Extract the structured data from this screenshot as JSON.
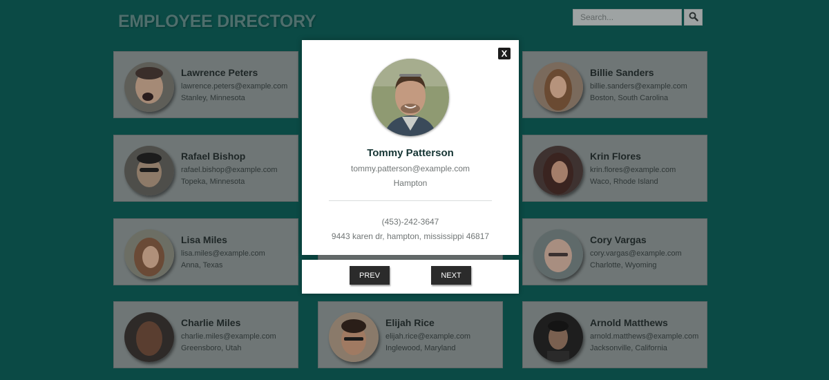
{
  "header": {
    "title": "EMPLOYEE DIRECTORY"
  },
  "search": {
    "placeholder": "Search...",
    "button_icon": "search-icon"
  },
  "colors": {
    "background": "#0b4a45",
    "card_overlay": "#6f7676",
    "modal_background": "#ffffff",
    "button_dark": "#2b2b2b",
    "name_accent": "#163534"
  },
  "employees": [
    {
      "name": "Lawrence Peters",
      "email": "lawrence.peters@example.com",
      "location": "Stanley, Minnesota"
    },
    {
      "name": "Billie Sanders",
      "email": "billie.sanders@example.com",
      "location": "Boston, South Carolina"
    },
    {
      "name": "Rafael Bishop",
      "email": "rafael.bishop@example.com",
      "location": "Topeka, Minnesota"
    },
    {
      "name": "Krin Flores",
      "email": "krin.flores@example.com",
      "location": "Waco, Rhode Island"
    },
    {
      "name": "Lisa Miles",
      "email": "lisa.miles@example.com",
      "location": "Anna, Texas"
    },
    {
      "name": "Cory Vargas",
      "email": "cory.vargas@example.com",
      "location": "Charlotte, Wyoming"
    },
    {
      "name": "Charlie Miles",
      "email": "charlie.miles@example.com",
      "location": "Greensboro, Utah"
    },
    {
      "name": "Elijah Rice",
      "email": "elijah.rice@example.com",
      "location": "Inglewood, Maryland"
    },
    {
      "name": "Arnold Matthews",
      "email": "arnold.matthews@example.com",
      "location": "Jacksonville, California"
    }
  ],
  "modal": {
    "close_label": "X",
    "name": "Tommy Patterson",
    "email": "tommy.patterson@example.com",
    "city": "Hampton",
    "phone": "(453)-242-3647",
    "address": "9443 karen dr, hampton, mississippi 46817",
    "prev_label": "PREV",
    "next_label": "NEXT"
  }
}
